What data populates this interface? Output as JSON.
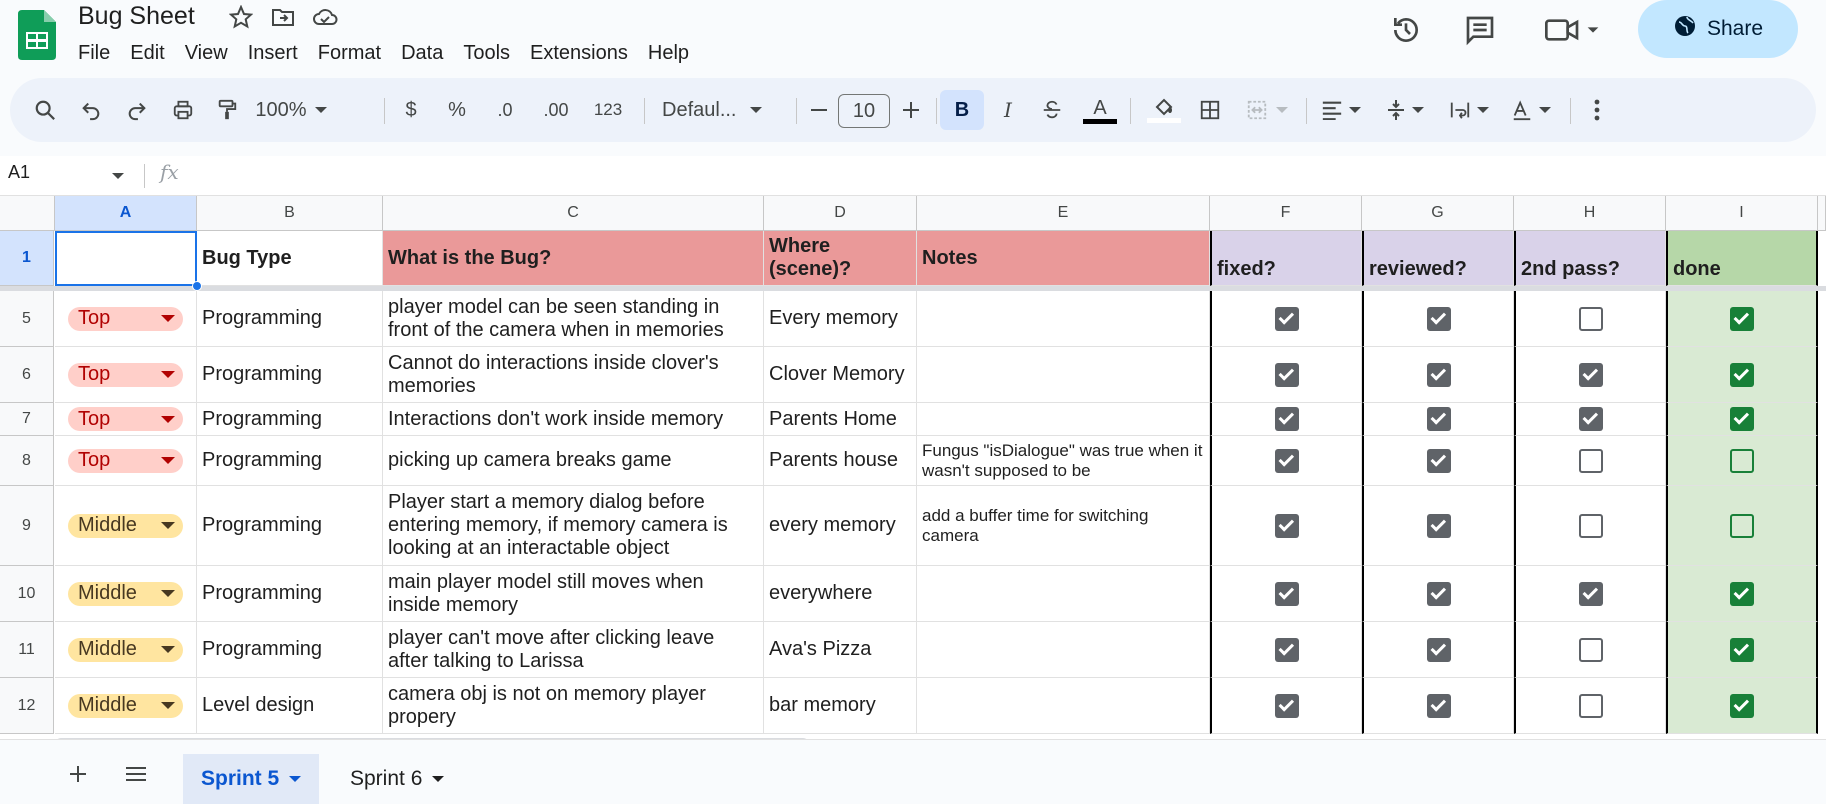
{
  "app": {
    "doc_title": "Bug Sheet",
    "share_label": "Share"
  },
  "menu": [
    "File",
    "Edit",
    "View",
    "Insert",
    "Format",
    "Data",
    "Tools",
    "Extensions",
    "Help"
  ],
  "toolbar": {
    "zoom": "100%",
    "currency": "$",
    "percent": "%",
    "dec_decrease": ".0",
    "dec_increase": ".00",
    "number_format": "123",
    "font": "Defaul...",
    "font_size": "10",
    "bold": "B",
    "italic": "I",
    "text_color_glyph": "A"
  },
  "formula_bar": {
    "name_box": "A1",
    "fx": "fx"
  },
  "columns": [
    "A",
    "B",
    "C",
    "D",
    "E",
    "F",
    "G",
    "H",
    "I"
  ],
  "header_row": {
    "row_num": "1",
    "a": "",
    "b": "Bug Type",
    "c": "What is the Bug?",
    "d": "Where (scene)?",
    "e": "Notes",
    "f": "fixed?",
    "g": "reviewed?",
    "h": "2nd pass?",
    "i": "done"
  },
  "rows": [
    {
      "num": "5",
      "priority": "Top",
      "type": "Programming",
      "bug": "player model can be seen standing in front of the camera when in memories",
      "where": "Every memory",
      "notes": "",
      "fixed": true,
      "reviewed": true,
      "pass2": false,
      "done": true
    },
    {
      "num": "6",
      "priority": "Top",
      "type": "Programming",
      "bug": "Cannot do interactions inside clover's memories",
      "where": "Clover Memory",
      "notes": "",
      "fixed": true,
      "reviewed": true,
      "pass2": true,
      "done": true
    },
    {
      "num": "7",
      "priority": "Top",
      "type": "Programming",
      "bug": "Interactions don't work inside memory",
      "where": "Parents Home",
      "notes": "",
      "fixed": true,
      "reviewed": true,
      "pass2": true,
      "done": true
    },
    {
      "num": "8",
      "priority": "Top",
      "type": "Programming",
      "bug": "picking up camera breaks game",
      "where": "Parents house",
      "notes": "Fungus \"isDialogue\" was true when it wasn't supposed to be",
      "fixed": true,
      "reviewed": true,
      "pass2": false,
      "done": false
    },
    {
      "num": "9",
      "priority": "Middle",
      "type": "Programming",
      "bug": "Player start a memory dialog before entering memory, if memory camera is looking at an interactable object",
      "where": "every memory",
      "notes": "add a buffer time for switching camera",
      "fixed": true,
      "reviewed": true,
      "pass2": false,
      "done": false
    },
    {
      "num": "10",
      "priority": "Middle",
      "type": "Programming",
      "bug": "main player model still moves when inside memory",
      "where": "everywhere",
      "notes": "",
      "fixed": true,
      "reviewed": true,
      "pass2": true,
      "done": true
    },
    {
      "num": "11",
      "priority": "Middle",
      "type": "Programming",
      "bug": "player can't move after clicking leave after talking to Larissa",
      "where": "Ava's Pizza",
      "notes": "",
      "fixed": true,
      "reviewed": true,
      "pass2": false,
      "done": true
    },
    {
      "num": "12",
      "priority": "Middle",
      "type": "Level design",
      "bug": "camera obj is not on memory player propery",
      "where": "bar memory",
      "notes": "",
      "fixed": true,
      "reviewed": true,
      "pass2": false,
      "done": true
    }
  ],
  "sheets": {
    "active": "Sprint 5",
    "other": "Sprint 6"
  },
  "colors": {
    "top_chip_bg": "#ffcfc9",
    "top_chip_fg": "#b10202",
    "middle_chip_bg": "#ffe5a0",
    "middle_chip_fg": "#473821",
    "red_header": "#ea9999",
    "purple_header": "#d9d2e9",
    "green_header": "#b6d7a8",
    "green_col": "#d9ead3"
  }
}
